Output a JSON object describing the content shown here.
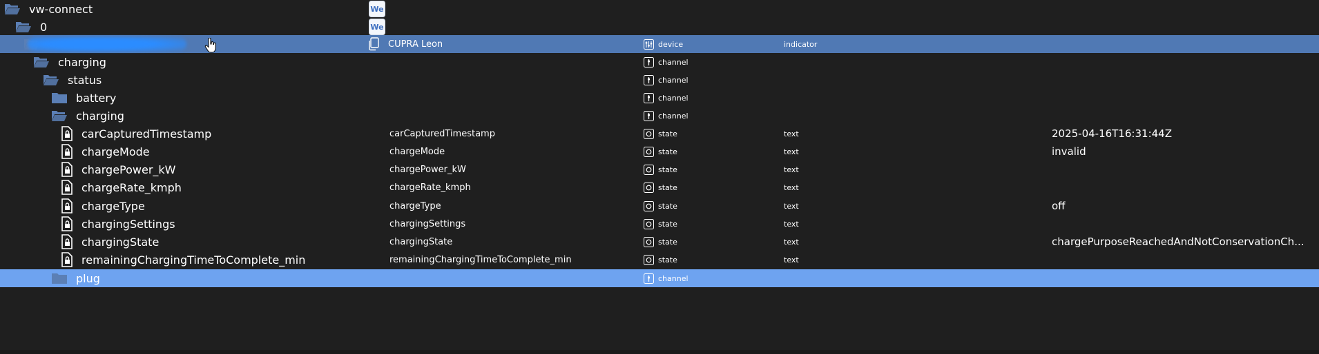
{
  "tree": {
    "rows": [
      {
        "name": "vw-connect",
        "type": "folder-open",
        "we_icon": true
      },
      {
        "name": "0",
        "type": "folder-open",
        "we_icon": true
      },
      {
        "name": "",
        "type": "folder-open",
        "redacted": true,
        "col_name": "CUPRA Leon",
        "role": "device",
        "obj_type": "indicator",
        "selected": "dark"
      },
      {
        "name": "charging",
        "type": "folder-open",
        "role": "channel"
      },
      {
        "name": "status",
        "type": "folder-open",
        "role": "channel"
      },
      {
        "name": "battery",
        "type": "folder-closed",
        "role": "channel"
      },
      {
        "name": "charging",
        "type": "folder-open",
        "role": "channel"
      },
      {
        "name": "carCapturedTimestamp",
        "type": "state",
        "col_name": "carCapturedTimestamp",
        "role": "state",
        "obj_type": "text",
        "value": "2025-04-16T16:31:44Z"
      },
      {
        "name": "chargeMode",
        "type": "state",
        "col_name": "chargeMode",
        "role": "state",
        "obj_type": "text",
        "value": "invalid"
      },
      {
        "name": "chargePower_kW",
        "type": "state",
        "col_name": "chargePower_kW",
        "role": "state",
        "obj_type": "text",
        "value": ""
      },
      {
        "name": "chargeRate_kmph",
        "type": "state",
        "col_name": "chargeRate_kmph",
        "role": "state",
        "obj_type": "text",
        "value": ""
      },
      {
        "name": "chargeType",
        "type": "state",
        "col_name": "chargeType",
        "role": "state",
        "obj_type": "text",
        "value": "off"
      },
      {
        "name": "chargingSettings",
        "type": "state",
        "col_name": "chargingSettings",
        "role": "state",
        "obj_type": "text",
        "value": ""
      },
      {
        "name": "chargingState",
        "type": "state",
        "col_name": "chargingState",
        "role": "state",
        "obj_type": "text",
        "value": "chargePurposeReachedAndNotConservationCh..."
      },
      {
        "name": "remainingChargingTimeToComplete_min",
        "type": "state",
        "col_name": "remainingChargingTimeToComplete_min",
        "role": "state",
        "obj_type": "text",
        "value": ""
      },
      {
        "name": "plug",
        "type": "folder-closed",
        "role": "channel",
        "selected": "light"
      }
    ]
  },
  "icons": {
    "folder_open": "folder-open-icon",
    "folder_closed": "folder-closed-icon",
    "state": "lock-file-icon",
    "we": "we-adapter-icon",
    "copy": "copy-icon",
    "device_role": "device-sliders-icon",
    "channel_role": "channel-icon",
    "state_role": "state-circle-icon",
    "cursor": "hand-pointer-icon"
  },
  "colors": {
    "background": "#1f1f1f",
    "selected_dark": "#5079b4",
    "selected_light": "#6ea3f0",
    "folder": "#5b7fb5"
  }
}
